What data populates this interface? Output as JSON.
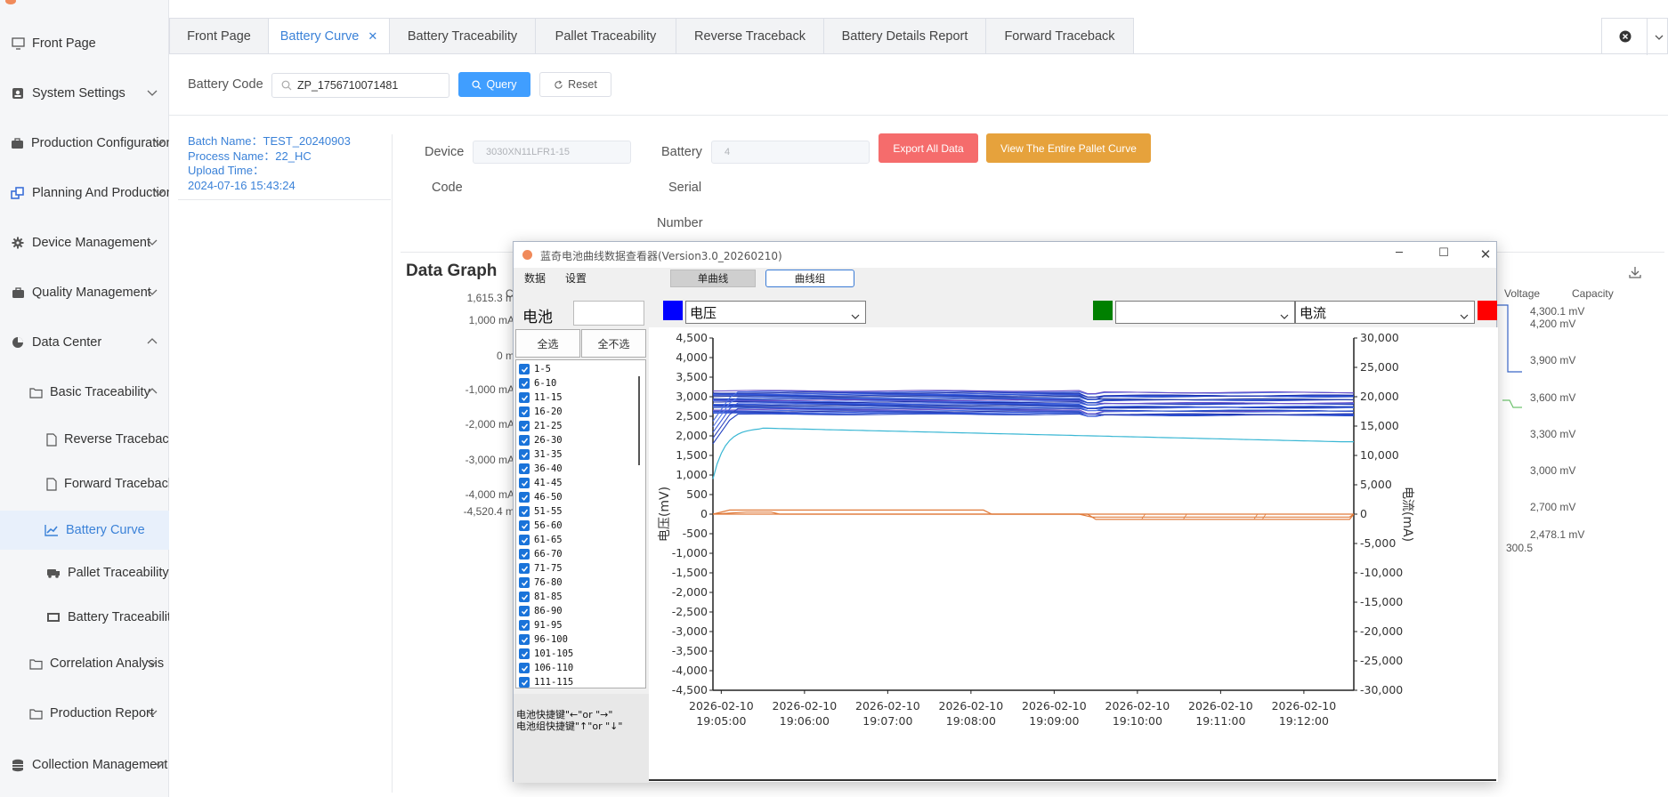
{
  "sidebar": {
    "items": [
      {
        "label": "Front Page"
      },
      {
        "label": "System Settings"
      },
      {
        "label": "Production Configuration"
      },
      {
        "label": "Planning And Production"
      },
      {
        "label": "Device Management"
      },
      {
        "label": "Quality Management"
      },
      {
        "label": "Data Center"
      },
      {
        "label": "Basic Traceability"
      },
      {
        "label": "Reverse Traceback"
      },
      {
        "label": "Forward Traceback"
      },
      {
        "label": "Battery Curve"
      },
      {
        "label": "Pallet Traceability"
      },
      {
        "label": "Battery Traceability"
      },
      {
        "label": "Correlation Analysis"
      },
      {
        "label": "Production Report"
      },
      {
        "label": "Collection Management"
      }
    ]
  },
  "tabs": [
    {
      "label": "Front Page"
    },
    {
      "label": "Battery Curve"
    },
    {
      "label": "Battery Traceability"
    },
    {
      "label": "Pallet Traceability"
    },
    {
      "label": "Reverse Traceback"
    },
    {
      "label": "Battery Details Report"
    },
    {
      "label": "Forward Traceback"
    }
  ],
  "search": {
    "label": "Battery Code",
    "value": "ZP_1756710071481",
    "query_label": "Query",
    "reset_label": "Reset"
  },
  "batch": {
    "batch_name": "Batch Name：TEST_20240903",
    "process_name": "Process Name：22_HC",
    "upload_time_label": "Upload Time：",
    "upload_time": "2024-07-16 15:43:24"
  },
  "device": {
    "label_line1": "Device",
    "label_line2": "Code",
    "value": "3030XN11LFR1-15",
    "serial_line1": "Battery",
    "serial_line2": "Serial",
    "serial_line3": "Number",
    "serial_value": "4",
    "export_label": "Export All Data",
    "pallet_label": "View The Entire Pallet Curve"
  },
  "graph": {
    "title": "Data Graph",
    "left_axis_head": "C",
    "left_axis": [
      "1,615.3 m",
      "1,000 mA",
      "0 m",
      "-1,000 mA",
      "-2,000 mA",
      "-3,000 mA",
      "-4,000 mA",
      "-4,520.4 m"
    ],
    "right_head_voltage": "Voltage",
    "right_head_capacity": "Capacity",
    "right_axis": [
      "4,300.1 mV",
      "4,200 mV",
      "3,900 mV",
      "3,600 mV",
      "3,300 mV",
      "3,000 mV",
      "2,700 mV",
      "2,478.1 mV"
    ],
    "x_end_label": "300.5"
  },
  "viewer": {
    "title": "蓝奇电池曲线数据查看器(Version3.0_20260210)",
    "menu_data": "数据",
    "menu_settings": "设置",
    "mode_single": "单曲线",
    "mode_group": "曲线组",
    "cell_label": "电池",
    "select_all": "全选",
    "select_none": "全不选",
    "cells": [
      "1-5",
      "6-10",
      "11-15",
      "16-20",
      "21-25",
      "26-30",
      "31-35",
      "36-40",
      "41-45",
      "46-50",
      "51-55",
      "56-60",
      "61-65",
      "66-70",
      "71-75",
      "76-80",
      "81-85",
      "86-90",
      "91-95",
      "96-100",
      "101-105",
      "106-110",
      "111-115"
    ],
    "hint_line1": "电池快捷键\"←\"or \"→\"",
    "hint_line2": "电池组快捷键\"↑\"or \"↓\"",
    "combo_left": "电压",
    "combo_mid": "",
    "combo_right": "电流",
    "colors": {
      "left_swatch": "#0000ff",
      "mid_swatch": "#008000",
      "right_swatch": "#ff0000"
    }
  },
  "chart_data": {
    "type": "line",
    "ylabel": "电压(mV)",
    "y2label": "电流(mA)",
    "ylim": [
      -4500,
      4500
    ],
    "y2lim": [
      -30000,
      30000
    ],
    "yticks": [
      4500,
      4000,
      3500,
      3000,
      2500,
      2000,
      1500,
      1000,
      500,
      0,
      -500,
      -1000,
      -1500,
      -2000,
      -2500,
      -3000,
      -3500,
      -4000,
      -4500
    ],
    "y2ticks": [
      30000,
      25000,
      20000,
      15000,
      10000,
      5000,
      0,
      -5000,
      -10000,
      -15000,
      -20000,
      -25000,
      -30000
    ],
    "xticks": [
      {
        "date": "2026-02-10",
        "time": "19:05:00"
      },
      {
        "date": "2026-02-10",
        "time": "19:06:00"
      },
      {
        "date": "2026-02-10",
        "time": "19:07:00"
      },
      {
        "date": "2026-02-10",
        "time": "19:08:00"
      },
      {
        "date": "2026-02-10",
        "time": "19:09:00"
      },
      {
        "date": "2026-02-10",
        "time": "19:10:00"
      },
      {
        "date": "2026-02-10",
        "time": "19:11:00"
      },
      {
        "date": "2026-02-10",
        "time": "19:12:00"
      }
    ],
    "xlim_minutes_from_first_tick": [
      -0.1,
      7.6
    ],
    "series_voltage_band": {
      "min": 2550,
      "max": 3150
    },
    "series_cyan": {
      "color": "#3ab7d4",
      "start": 900,
      "peak": 2200,
      "end": 1850
    },
    "series_current": {
      "color": "#e07a3a",
      "level": 0
    }
  }
}
